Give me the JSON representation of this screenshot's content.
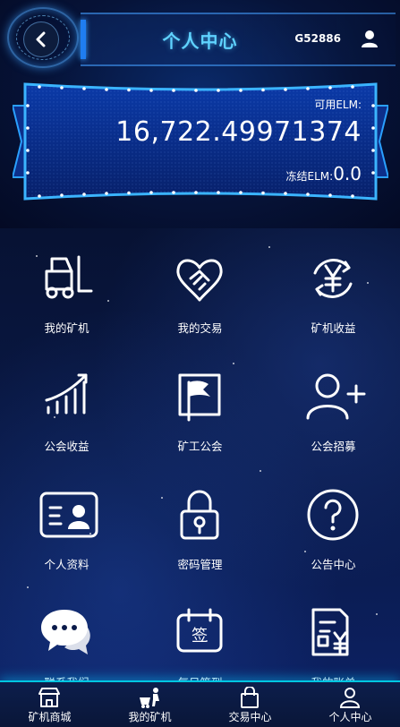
{
  "header": {
    "title": "个人中心",
    "user_id": "G52886"
  },
  "balance": {
    "available_label": "可用ELM:",
    "available_value": "16,722.49971374",
    "frozen_label": "冻结ELM:",
    "frozen_value": "0.0"
  },
  "grid_items": [
    {
      "label": "我的矿机",
      "icon": "forklift-icon"
    },
    {
      "label": "我的交易",
      "icon": "handshake-icon"
    },
    {
      "label": "矿机收益",
      "icon": "yuan-cycle-icon"
    },
    {
      "label": "公会收益",
      "icon": "trend-chart-icon"
    },
    {
      "label": "矿工公会",
      "icon": "flag-icon"
    },
    {
      "label": "公会招募",
      "icon": "add-user-icon"
    },
    {
      "label": "个人资料",
      "icon": "id-card-icon"
    },
    {
      "label": "密码管理",
      "icon": "lock-icon"
    },
    {
      "label": "公告中心",
      "icon": "question-icon"
    },
    {
      "label": "联系我们",
      "icon": "chat-icon"
    },
    {
      "label": "每日签到",
      "icon": "sign-calendar-icon"
    },
    {
      "label": "我的账单",
      "icon": "bill-icon"
    }
  ],
  "bottom_nav": [
    {
      "label": "矿机商城",
      "icon": "shop-icon"
    },
    {
      "label": "我的矿机",
      "icon": "miner-icon"
    },
    {
      "label": "交易中心",
      "icon": "bag-icon"
    },
    {
      "label": "个人中心",
      "icon": "person-icon"
    }
  ],
  "colors": {
    "title": "#5fd2ff",
    "accent": "#1f7df0",
    "nav_glow": "#00e6ff"
  }
}
